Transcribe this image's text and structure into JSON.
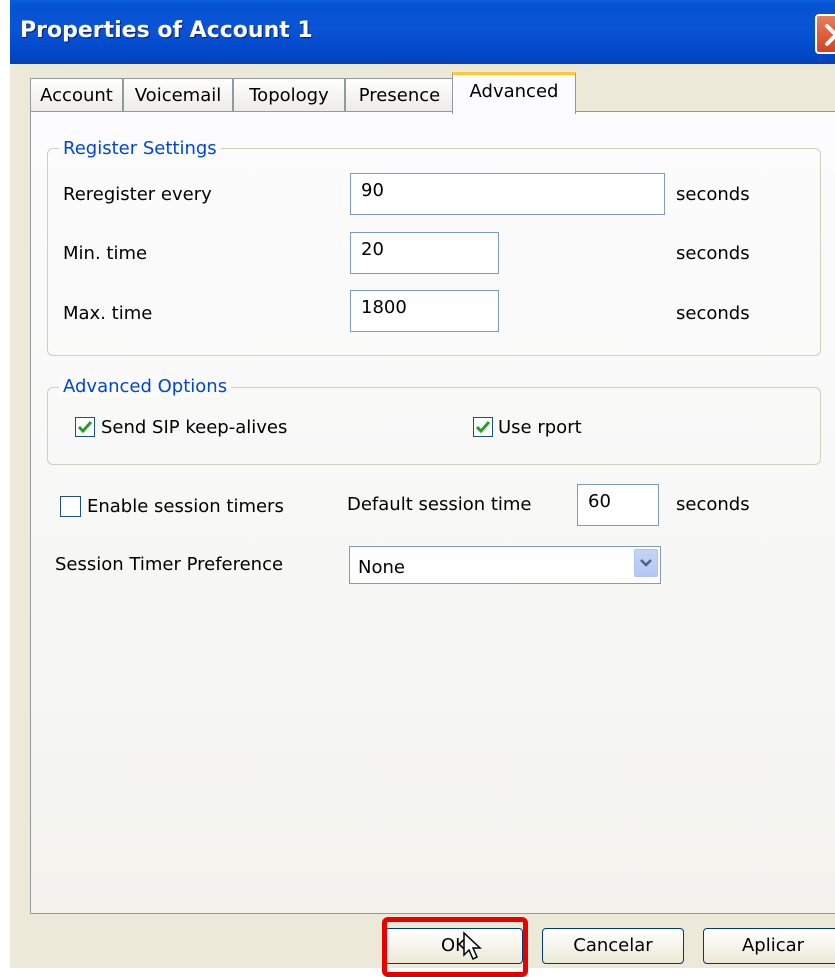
{
  "window": {
    "title": "Properties of Account 1"
  },
  "tabs": [
    {
      "label": "Account"
    },
    {
      "label": "Voicemail"
    },
    {
      "label": "Topology"
    },
    {
      "label": "Presence"
    },
    {
      "label": "Advanced"
    }
  ],
  "active_tab": "Advanced",
  "register_settings": {
    "legend": "Register Settings",
    "rows": [
      {
        "label": "Reregister every",
        "value": "90",
        "unit": "seconds"
      },
      {
        "label": "Min. time",
        "value": "20",
        "unit": "seconds"
      },
      {
        "label": "Max. time",
        "value": "1800",
        "unit": "seconds"
      }
    ]
  },
  "advanced_options": {
    "legend": "Advanced Options",
    "send_keepalives": {
      "label": "Send SIP keep-alives",
      "checked": true
    },
    "use_rport": {
      "label": "Use rport",
      "checked": true
    }
  },
  "session": {
    "enable_timers": {
      "label": "Enable session timers",
      "checked": false
    },
    "default_time_label": "Default session time",
    "default_time_value": "60",
    "default_time_unit": "seconds",
    "preference_label": "Session Timer Preference",
    "preference_value": "None"
  },
  "buttons": {
    "ok": "OK",
    "cancel": "Cancelar",
    "apply": "Aplicar"
  },
  "colors": {
    "titlebar": "#0a54d6",
    "group_label": "#0046d5",
    "highlight": "#e60000",
    "active_tab_accent": "#ffc83c"
  }
}
